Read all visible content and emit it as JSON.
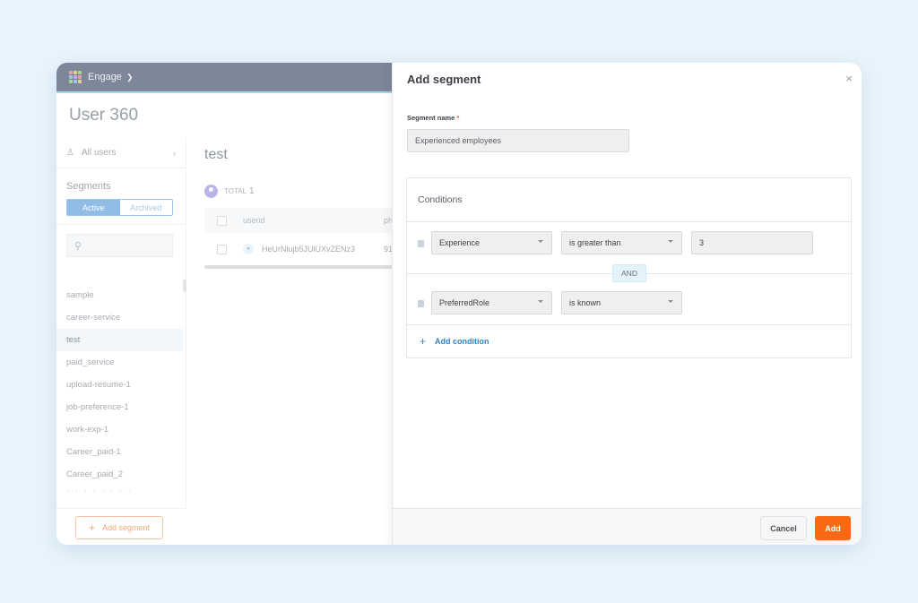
{
  "app": {
    "brand": "Engage",
    "page_title": "User 360",
    "colors": {
      "accent": "#f76a12",
      "link": "#2b86c8",
      "topbar": "#7d8799",
      "toggle_active": "#8fbde6"
    }
  },
  "sidebar": {
    "all_users_label": "All users",
    "segments_heading": "Segments",
    "tabs": [
      {
        "label": "Active",
        "selected": true
      },
      {
        "label": "Archived",
        "selected": false
      }
    ],
    "search_placeholder": "",
    "items": [
      {
        "label": "sample"
      },
      {
        "label": "career-service"
      },
      {
        "label": "test",
        "selected": true
      },
      {
        "label": "paid_service"
      },
      {
        "label": "upload-resume-1"
      },
      {
        "label": "job-preference-1"
      },
      {
        "label": "work-exp-1"
      },
      {
        "label": "Career_paid-1"
      },
      {
        "label": "Career_paid_2"
      }
    ],
    "add_segment_label": "Add segment"
  },
  "main": {
    "title": "test",
    "total_label": "TOTAL",
    "total_count": "1",
    "table": {
      "columns": [
        "userid",
        "ph"
      ],
      "rows": [
        {
          "userid": "HeUrNlujb5JUlUXvZENz3",
          "col2": "91"
        }
      ]
    }
  },
  "drawer": {
    "title": "Add segment",
    "close_label": "×",
    "segment_name_label": "Segment name",
    "required_marker": "*",
    "segment_name_value": "Experienced employees",
    "conditions_heading": "Conditions",
    "conditions": [
      {
        "property": "Experience",
        "operator": "is greater than",
        "value": "3"
      },
      {
        "property": "PreferredRole",
        "operator": "is known"
      }
    ],
    "joiner": "AND",
    "add_condition_label": "Add condition",
    "cancel_label": "Cancel",
    "add_label": "Add"
  }
}
